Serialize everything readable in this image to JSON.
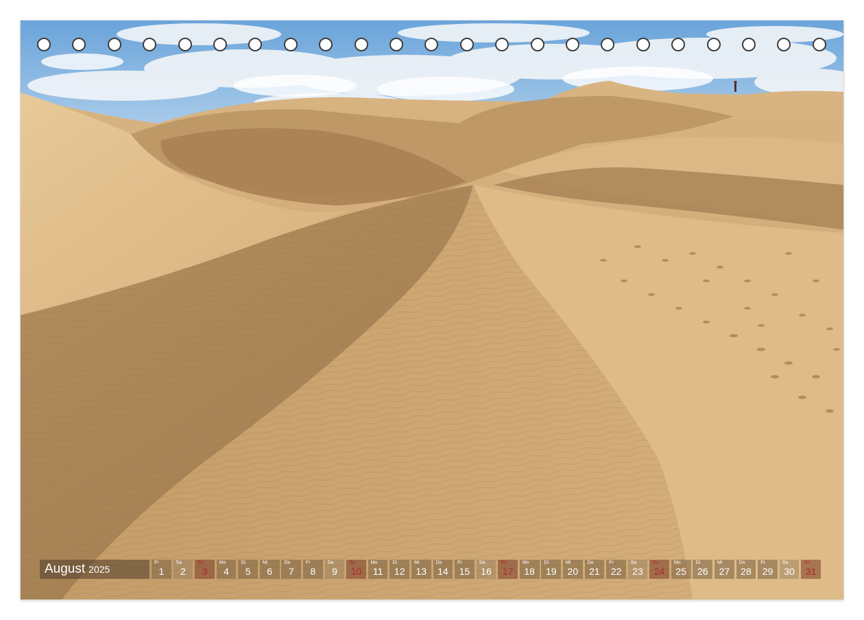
{
  "calendar": {
    "month": "August",
    "year": "2025",
    "days": [
      {
        "abbr": "Fr",
        "num": "1",
        "type": "weekday"
      },
      {
        "abbr": "Sa",
        "num": "2",
        "type": "weekend"
      },
      {
        "abbr": "So",
        "num": "3",
        "type": "sunday"
      },
      {
        "abbr": "Mo",
        "num": "4",
        "type": "weekday"
      },
      {
        "abbr": "Di",
        "num": "5",
        "type": "weekday"
      },
      {
        "abbr": "Mi",
        "num": "6",
        "type": "weekday"
      },
      {
        "abbr": "Do",
        "num": "7",
        "type": "weekday"
      },
      {
        "abbr": "Fr",
        "num": "8",
        "type": "weekday"
      },
      {
        "abbr": "Sa",
        "num": "9",
        "type": "weekend"
      },
      {
        "abbr": "So",
        "num": "10",
        "type": "sunday"
      },
      {
        "abbr": "Mo",
        "num": "11",
        "type": "weekday"
      },
      {
        "abbr": "Di",
        "num": "12",
        "type": "weekday"
      },
      {
        "abbr": "Mi",
        "num": "13",
        "type": "weekday"
      },
      {
        "abbr": "Do",
        "num": "14",
        "type": "weekday"
      },
      {
        "abbr": "Fr",
        "num": "15",
        "type": "weekday"
      },
      {
        "abbr": "Sa",
        "num": "16",
        "type": "weekend"
      },
      {
        "abbr": "So",
        "num": "17",
        "type": "sunday"
      },
      {
        "abbr": "Mo",
        "num": "18",
        "type": "weekday"
      },
      {
        "abbr": "Di",
        "num": "19",
        "type": "weekday"
      },
      {
        "abbr": "Mi",
        "num": "20",
        "type": "weekday"
      },
      {
        "abbr": "Do",
        "num": "21",
        "type": "weekday"
      },
      {
        "abbr": "Fr",
        "num": "22",
        "type": "weekday"
      },
      {
        "abbr": "Sa",
        "num": "23",
        "type": "weekend"
      },
      {
        "abbr": "So",
        "num": "24",
        "type": "sunday"
      },
      {
        "abbr": "Mo",
        "num": "25",
        "type": "weekday"
      },
      {
        "abbr": "Di",
        "num": "26",
        "type": "weekday"
      },
      {
        "abbr": "Mi",
        "num": "27",
        "type": "weekday"
      },
      {
        "abbr": "Do",
        "num": "28",
        "type": "weekday"
      },
      {
        "abbr": "Fr",
        "num": "29",
        "type": "weekday"
      },
      {
        "abbr": "Sa",
        "num": "30",
        "type": "weekend"
      },
      {
        "abbr": "So",
        "num": "31",
        "type": "sunday"
      }
    ]
  },
  "ring_hole_count": 23,
  "colors": {
    "sky": "#7fb2e0",
    "sand_light": "#e2bf8c",
    "sand_mid": "#c9a06a",
    "sand_shadow": "#9c7950",
    "sunday_red": "#b2282a"
  }
}
